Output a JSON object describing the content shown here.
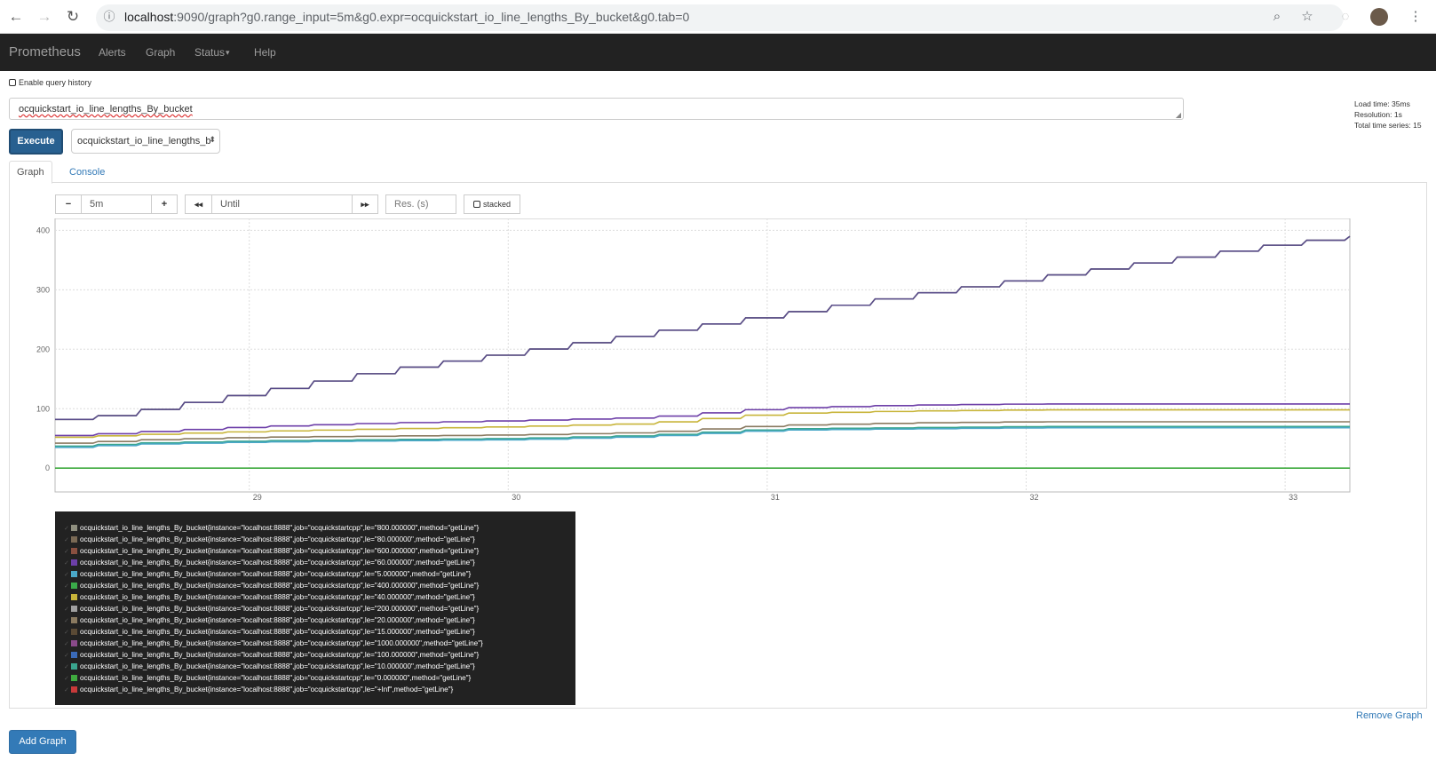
{
  "browser": {
    "url_host": "localhost",
    "url_rest": ":9090/graph?g0.range_input=5m&g0.expr=ocquickstart_io_line_lengths_By_bucket&g0.tab=0"
  },
  "nav": {
    "brand": "Prometheus",
    "items": [
      "Alerts",
      "Graph",
      "Status",
      "Help"
    ],
    "status_caret": "▾"
  },
  "query": {
    "history_label": "Enable query history",
    "expression": "ocquickstart_io_line_lengths_By_bucket",
    "execute_label": "Execute",
    "metric_select": "ocquickstart_io_line_lengths_b"
  },
  "stats": {
    "load_time": "Load time: 35ms",
    "resolution": "Resolution: 1s",
    "total_series": "Total time series: 15"
  },
  "tabs": {
    "graph": "Graph",
    "console": "Console"
  },
  "controls": {
    "minus": "−",
    "range": "5m",
    "plus": "+",
    "back": "◂◂",
    "until_placeholder": "Until",
    "fwd": "▸▸",
    "res_placeholder": "Res. (s)",
    "stacked_label": "stacked"
  },
  "chart_data": {
    "type": "line",
    "y_ticks": [
      "0",
      "100",
      "200",
      "300",
      "400"
    ],
    "x_ticks": [
      "29",
      "30",
      "31",
      "32",
      "33"
    ],
    "ylim": [
      0,
      400
    ],
    "grid": true,
    "legend_position": "bottom",
    "x": [
      28.3,
      28.5,
      29,
      29.5,
      30,
      30.5,
      31,
      31.5,
      32,
      32.5,
      33,
      33.25
    ],
    "series": [
      {
        "name": "+Inf",
        "color": "#7f7f6f",
        "values": [
          82,
          93,
          128,
          165,
          195,
          227,
          258,
          290,
          320,
          350,
          380,
          390
        ]
      },
      {
        "name": "1000",
        "color": "#5a4d8a",
        "values": [
          82,
          93,
          128,
          165,
          195,
          227,
          258,
          290,
          320,
          350,
          380,
          390
        ]
      },
      {
        "name": "60",
        "color": "#6d3fa8",
        "values": [
          55,
          60,
          70,
          76,
          80,
          85,
          101,
          106,
          108,
          108,
          108,
          108
        ]
      },
      {
        "name": "40",
        "color": "#c8b53a",
        "values": [
          52,
          56,
          62,
          66,
          70,
          75,
          92,
          96,
          98,
          98,
          98,
          98
        ]
      },
      {
        "name": "20",
        "color": "#8a7a60",
        "values": [
          42,
          47,
          52,
          54,
          56,
          60,
          72,
          76,
          78,
          78,
          78,
          78
        ]
      },
      {
        "name": "10",
        "color": "#3aa58e",
        "values": [
          37,
          42,
          46,
          48,
          50,
          55,
          66,
          68,
          70,
          70,
          70,
          70
        ]
      },
      {
        "name": "5",
        "color": "#4aa8c8",
        "values": [
          35,
          40,
          44,
          46,
          48,
          53,
          64,
          66,
          68,
          68,
          68,
          68
        ]
      },
      {
        "name": "0",
        "color": "#3faa3f",
        "values": [
          0,
          0,
          0,
          0,
          0,
          0,
          0,
          0,
          0,
          0,
          0,
          0
        ]
      }
    ]
  },
  "legend": [
    {
      "text": "ocquickstart_io_line_lengths_By_bucket{instance=\"localhost:8888\",job=\"ocquickstartcpp\",le=\"800.000000\",method=\"getLine\"}",
      "color": "#8f8f7f"
    },
    {
      "text": "ocquickstart_io_line_lengths_By_bucket{instance=\"localhost:8888\",job=\"ocquickstartcpp\",le=\"80.000000\",method=\"getLine\"}",
      "color": "#7a6a55"
    },
    {
      "text": "ocquickstart_io_line_lengths_By_bucket{instance=\"localhost:8888\",job=\"ocquickstartcpp\",le=\"600.000000\",method=\"getLine\"}",
      "color": "#8a5040"
    },
    {
      "text": "ocquickstart_io_line_lengths_By_bucket{instance=\"localhost:8888\",job=\"ocquickstartcpp\",le=\"60.000000\",method=\"getLine\"}",
      "color": "#6d3fa8"
    },
    {
      "text": "ocquickstart_io_line_lengths_By_bucket{instance=\"localhost:8888\",job=\"ocquickstartcpp\",le=\"5.000000\",method=\"getLine\"}",
      "color": "#4aa8c8"
    },
    {
      "text": "ocquickstart_io_line_lengths_By_bucket{instance=\"localhost:8888\",job=\"ocquickstartcpp\",le=\"400.000000\",method=\"getLine\"}",
      "color": "#3aaa4a"
    },
    {
      "text": "ocquickstart_io_line_lengths_By_bucket{instance=\"localhost:8888\",job=\"ocquickstartcpp\",le=\"40.000000\",method=\"getLine\"}",
      "color": "#c8b53a"
    },
    {
      "text": "ocquickstart_io_line_lengths_By_bucket{instance=\"localhost:8888\",job=\"ocquickstartcpp\",le=\"200.000000\",method=\"getLine\"}",
      "color": "#a0a0a0"
    },
    {
      "text": "ocquickstart_io_line_lengths_By_bucket{instance=\"localhost:8888\",job=\"ocquickstartcpp\",le=\"20.000000\",method=\"getLine\"}",
      "color": "#8a7a60"
    },
    {
      "text": "ocquickstart_io_line_lengths_By_bucket{instance=\"localhost:8888\",job=\"ocquickstartcpp\",le=\"15.000000\",method=\"getLine\"}",
      "color": "#5a4a35"
    },
    {
      "text": "ocquickstart_io_line_lengths_By_bucket{instance=\"localhost:8888\",job=\"ocquickstartcpp\",le=\"1000.000000\",method=\"getLine\"}",
      "color": "#8a4a8a"
    },
    {
      "text": "ocquickstart_io_line_lengths_By_bucket{instance=\"localhost:8888\",job=\"ocquickstartcpp\",le=\"100.000000\",method=\"getLine\"}",
      "color": "#3a6ab8"
    },
    {
      "text": "ocquickstart_io_line_lengths_By_bucket{instance=\"localhost:8888\",job=\"ocquickstartcpp\",le=\"10.000000\",method=\"getLine\"}",
      "color": "#3aa58e"
    },
    {
      "text": "ocquickstart_io_line_lengths_By_bucket{instance=\"localhost:8888\",job=\"ocquickstartcpp\",le=\"0.000000\",method=\"getLine\"}",
      "color": "#3faa3f"
    },
    {
      "text": "ocquickstart_io_line_lengths_By_bucket{instance=\"localhost:8888\",job=\"ocquickstartcpp\",le=\"+Inf\",method=\"getLine\"}",
      "color": "#c83a3a"
    }
  ],
  "footer": {
    "remove_graph": "Remove Graph",
    "add_graph": "Add Graph"
  }
}
